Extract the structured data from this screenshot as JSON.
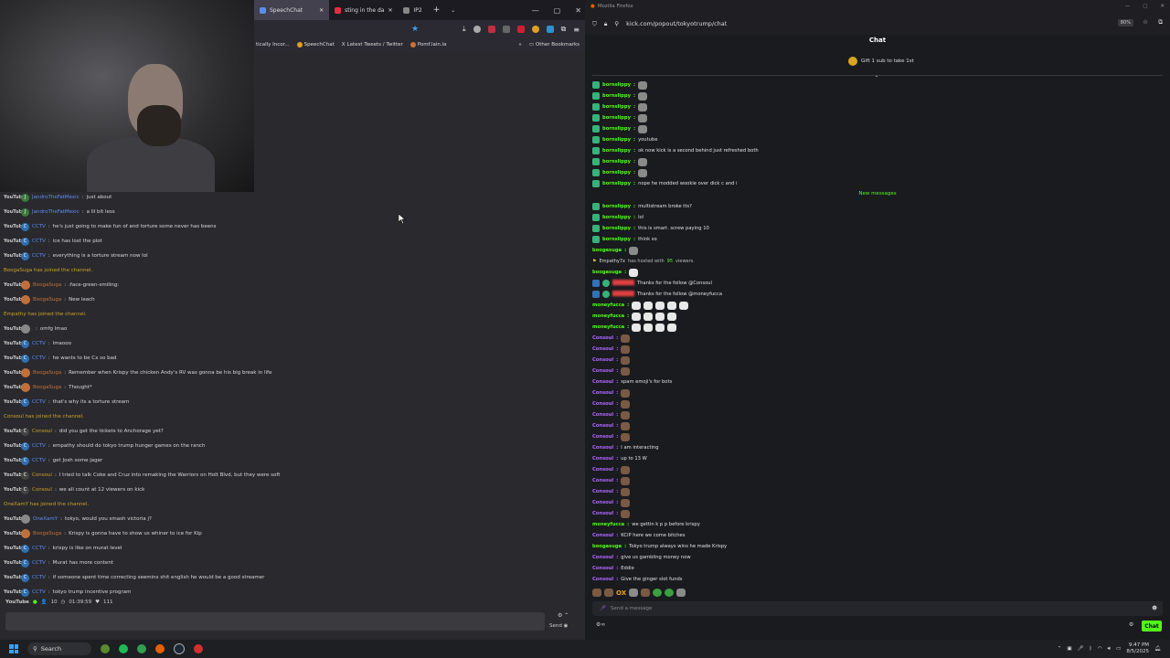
{
  "left_window": {
    "tabs": [
      {
        "label": "SpeechChat",
        "active": true,
        "color": "#5b8def"
      },
      {
        "label": "sting in the da",
        "active": false,
        "color": "#e03040"
      },
      {
        "label": "IP2",
        "active": false,
        "color": "#888888"
      }
    ],
    "new_tab": "+",
    "bookmarks": [
      {
        "label": "tically Incor..."
      },
      {
        "label": "SpeechChat"
      },
      {
        "label": "Latest Tweets / Twitter"
      },
      {
        "label": "Pomf.lain.la"
      }
    ],
    "other_bookmarks": "Other Bookmarks",
    "chat": [
      {
        "platform": "YouTube",
        "badge": "J",
        "user": "JandroTheFatMexic",
        "msg": "just about",
        "kind": "msg",
        "ucolor": "#5b8def"
      },
      {
        "platform": "YouTube",
        "badge": "J",
        "user": "JandroTheFatMexic",
        "msg": "a lil bit less",
        "kind": "msg",
        "ucolor": "#5b8def"
      },
      {
        "platform": "YouTube",
        "badge": "C",
        "user": "CCTV",
        "msg": "he's just going to make fun of and torture some never has beens",
        "kind": "msg",
        "ucolor": "#5b8def"
      },
      {
        "platform": "YouTube",
        "badge": "C",
        "user": "CCTV",
        "msg": "ice has lost the plot",
        "kind": "msg",
        "ucolor": "#5b8def"
      },
      {
        "platform": "YouTube",
        "badge": "C",
        "user": "CCTV",
        "msg": "everything is a torture stream now lol",
        "kind": "msg",
        "ucolor": "#5b8def"
      },
      {
        "text": "BoogaSuga has joined the channel.",
        "kind": "join"
      },
      {
        "platform": "YouTube",
        "badge": "av",
        "user": "BoogaSuga",
        "msg": ":face-green-smiling:",
        "kind": "msg",
        "ucolor": "#c2703b"
      },
      {
        "platform": "YouTube",
        "badge": "av",
        "user": "BoogaSuga",
        "msg": "New leach",
        "kind": "msg",
        "ucolor": "#c2703b"
      },
      {
        "text": "Empathy has joined the channel.",
        "kind": "join"
      },
      {
        "platform": "YouTube",
        "badge": "avg",
        "user": "",
        "msg": "omfg lmao",
        "kind": "msg",
        "ucolor": "#e04040"
      },
      {
        "platform": "YouTube",
        "badge": "C",
        "user": "CCTV",
        "msg": "lmaooo",
        "kind": "msg",
        "ucolor": "#5b8def"
      },
      {
        "platform": "YouTube",
        "badge": "C",
        "user": "CCTV",
        "msg": "he wants to be Cx so bad",
        "kind": "msg",
        "ucolor": "#5b8def"
      },
      {
        "platform": "YouTube",
        "badge": "av",
        "user": "BoogaSuga",
        "msg": "Remember when Krispy the chicken Andy's RV was gonna be his big break in life",
        "kind": "msg",
        "ucolor": "#c2703b"
      },
      {
        "platform": "YouTube",
        "badge": "av",
        "user": "BoogaSuga",
        "msg": "Thought*",
        "kind": "msg",
        "ucolor": "#c2703b"
      },
      {
        "platform": "YouTube",
        "badge": "C",
        "user": "CCTV",
        "msg": "that's why its a torture stream",
        "kind": "msg",
        "ucolor": "#5b8def"
      },
      {
        "text": "Consoul has joined the channel.",
        "kind": "join"
      },
      {
        "platform": "YouTube",
        "badge": "Cp",
        "user": "Consoul",
        "msg": "did you get the tickets to Anchorage yet?",
        "kind": "msg",
        "ucolor": "#c9a227"
      },
      {
        "platform": "YouTube",
        "badge": "C",
        "user": "CCTV",
        "msg": "empathy should do tokyo trump hunger games on the ranch",
        "kind": "msg",
        "ucolor": "#5b8def"
      },
      {
        "platform": "YouTube",
        "badge": "C",
        "user": "CCTV",
        "msg": "get Josh some jager",
        "kind": "msg",
        "ucolor": "#5b8def"
      },
      {
        "platform": "YouTube",
        "badge": "Cp",
        "user": "Consoul",
        "msg": "I tried to talk Coke and Cruz into remaking the Warriors on Holt Blvd, but they were soft",
        "kind": "msg",
        "ucolor": "#c9a227"
      },
      {
        "platform": "YouTube",
        "badge": "Cp",
        "user": "Consoul",
        "msg": "we all count at 12 viewers on kick",
        "kind": "msg",
        "ucolor": "#c9a227"
      },
      {
        "text": "OneXamY has joined the channel.",
        "kind": "join"
      },
      {
        "platform": "YouTube",
        "badge": "avg",
        "user": "OneXamY",
        "msg": "tokyo, would you smash victoria j?",
        "kind": "msg",
        "ucolor": "#5b8def"
      },
      {
        "platform": "YouTube",
        "badge": "av",
        "user": "BoogaSuga",
        "msg": "Krispy is gonna have to show us whiner to ice for Kip",
        "kind": "msg",
        "ucolor": "#c2703b"
      },
      {
        "platform": "YouTube",
        "badge": "C",
        "user": "CCTV",
        "msg": "krispy is like on murat level",
        "kind": "msg",
        "ucolor": "#5b8def"
      },
      {
        "platform": "YouTube",
        "badge": "C",
        "user": "CCTV",
        "msg": "Murat has more content",
        "kind": "msg",
        "ucolor": "#5b8def"
      },
      {
        "platform": "YouTube",
        "badge": "C",
        "user": "CCTV",
        "msg": "if someone spent time correcting seemins shit english he would be a good streamer",
        "kind": "msg",
        "ucolor": "#5b8def"
      },
      {
        "platform": "YouTube",
        "badge": "C",
        "user": "CCTV",
        "msg": "tokyo trump incentive program",
        "kind": "msg",
        "ucolor": "#5b8def"
      }
    ],
    "stats": {
      "platform": "YouTube",
      "viewers": "10",
      "uptime": "01:39:59",
      "likes": "111"
    },
    "send_label": "Send"
  },
  "right_window": {
    "title": "Mozilla Firefox",
    "url": "kick.com/popout/tokyotrump/chat",
    "zoom": "80%",
    "chat_title": "Chat",
    "pinned": "Gift 1 sub to take 1st",
    "new_messages": "New messages",
    "host": {
      "user": "Empathy7x",
      "pre": "has hosted with",
      "count": "95",
      "post": "viewers."
    },
    "messages": [
      {
        "badge": "g",
        "user": "bornslippy",
        "cls": "u-green",
        "msg": "",
        "emotes": [
          "g"
        ]
      },
      {
        "badge": "g",
        "user": "bornslippy",
        "cls": "u-green",
        "msg": "",
        "emotes": [
          "g"
        ]
      },
      {
        "badge": "g",
        "user": "bornslippy",
        "cls": "u-green",
        "msg": "",
        "emotes": [
          "g"
        ]
      },
      {
        "badge": "g",
        "user": "bornslippy",
        "cls": "u-green",
        "msg": "",
        "emotes": [
          "g"
        ]
      },
      {
        "badge": "g",
        "user": "bornslippy",
        "cls": "u-green",
        "msg": "",
        "emotes": [
          "g"
        ]
      },
      {
        "badge": "g",
        "user": "bornslippy",
        "cls": "u-green",
        "msg": "youtube",
        "emotes": []
      },
      {
        "badge": "g",
        "user": "bornslippy",
        "cls": "u-green",
        "msg": "ok now kick is a second behind just refreshed both",
        "emotes": []
      },
      {
        "badge": "g",
        "user": "bornslippy",
        "cls": "u-green",
        "msg": "",
        "emotes": [
          "g"
        ]
      },
      {
        "badge": "g",
        "user": "bornslippy",
        "cls": "u-green",
        "msg": "",
        "emotes": [
          "g"
        ]
      },
      {
        "badge": "g",
        "user": "bornslippy",
        "cls": "u-green",
        "msg": "nope he modded wookie over dick c and i",
        "emotes": []
      },
      {
        "badge": "g",
        "user": "bornslippy",
        "cls": "u-green",
        "msg": "multistream broke tts?",
        "emotes": []
      },
      {
        "badge": "g",
        "user": "bornslippy",
        "cls": "u-green",
        "msg": "lol",
        "emotes": []
      },
      {
        "badge": "g",
        "user": "bornslippy",
        "cls": "u-green",
        "msg": "this is smart. screw paying 10",
        "emotes": []
      },
      {
        "badge": "g",
        "user": "bornslippy",
        "cls": "u-green",
        "msg": "think so",
        "emotes": []
      },
      {
        "badge": "",
        "user": "boogasuga",
        "cls": "u-green",
        "msg": "",
        "emotes": [
          "g"
        ]
      },
      {
        "badge": "",
        "user": "boogasuga",
        "cls": "u-green",
        "msg": "",
        "emotes": [
          "w"
        ]
      },
      {
        "badge": "b",
        "user": "",
        "cls": "u-red",
        "msg": "Thanks for the follow @Consoul",
        "emotes": []
      },
      {
        "badge": "b",
        "user": "",
        "cls": "u-red",
        "msg": "Thanks for the follow @moneyfucca",
        "emotes": []
      },
      {
        "badge": "",
        "user": "moneyfucca",
        "cls": "u-green",
        "msg": "",
        "emotes": [
          "w",
          "w",
          "w",
          "w",
          "w"
        ]
      },
      {
        "badge": "",
        "user": "moneyfucca",
        "cls": "u-green",
        "msg": "",
        "emotes": [
          "w",
          "w",
          "w",
          "w"
        ]
      },
      {
        "badge": "",
        "user": "moneyfucca",
        "cls": "u-green",
        "msg": "",
        "emotes": [
          "w",
          "w",
          "w",
          "w"
        ]
      },
      {
        "badge": "",
        "user": "Consoul",
        "cls": "u-purple",
        "msg": "",
        "emotes": [
          "b"
        ]
      },
      {
        "badge": "",
        "user": "Consoul",
        "cls": "u-purple",
        "msg": "",
        "emotes": [
          "b"
        ]
      },
      {
        "badge": "",
        "user": "Consoul",
        "cls": "u-purple",
        "msg": "",
        "emotes": [
          "b"
        ]
      },
      {
        "badge": "",
        "user": "Consoul",
        "cls": "u-purple",
        "msg": "",
        "emotes": [
          "b"
        ]
      },
      {
        "badge": "",
        "user": "Consoul",
        "cls": "u-purple",
        "msg": "spam emoji's for bots",
        "emotes": []
      },
      {
        "badge": "",
        "user": "Consoul",
        "cls": "u-purple",
        "msg": "",
        "emotes": [
          "b"
        ]
      },
      {
        "badge": "",
        "user": "Consoul",
        "cls": "u-purple",
        "msg": "",
        "emotes": [
          "b"
        ]
      },
      {
        "badge": "",
        "user": "Consoul",
        "cls": "u-purple",
        "msg": "",
        "emotes": [
          "b"
        ]
      },
      {
        "badge": "",
        "user": "Consoul",
        "cls": "u-purple",
        "msg": "",
        "emotes": [
          "b"
        ]
      },
      {
        "badge": "",
        "user": "Consoul",
        "cls": "u-purple",
        "msg": "",
        "emotes": [
          "b"
        ]
      },
      {
        "badge": "",
        "user": "Consoul",
        "cls": "u-purple",
        "msg": "I am interacting",
        "emotes": []
      },
      {
        "badge": "",
        "user": "Consoul",
        "cls": "u-purple",
        "msg": "up to 13 W",
        "emotes": []
      },
      {
        "badge": "",
        "user": "Consoul",
        "cls": "u-purple",
        "msg": "",
        "emotes": [
          "b"
        ]
      },
      {
        "badge": "",
        "user": "Consoul",
        "cls": "u-purple",
        "msg": "",
        "emotes": [
          "b"
        ]
      },
      {
        "badge": "",
        "user": "Consoul",
        "cls": "u-purple",
        "msg": "",
        "emotes": [
          "b"
        ]
      },
      {
        "badge": "",
        "user": "Consoul",
        "cls": "u-purple",
        "msg": "",
        "emotes": [
          "b"
        ]
      },
      {
        "badge": "",
        "user": "Consoul",
        "cls": "u-purple",
        "msg": "",
        "emotes": [
          "b"
        ]
      },
      {
        "badge": "",
        "user": "moneyfucca",
        "cls": "u-green",
        "msg": "we gettin k p p before krispy",
        "emotes": []
      },
      {
        "badge": "",
        "user": "Consoul",
        "cls": "u-purple",
        "msg": "KCIP here we come bitches",
        "emotes": []
      },
      {
        "badge": "",
        "user": "boogasuga",
        "cls": "u-green",
        "msg": "Tokyo trump always wins he made Krispy",
        "emotes": []
      },
      {
        "badge": "",
        "user": "Consoul",
        "cls": "u-purple",
        "msg": "give us gambling money now",
        "emotes": []
      },
      {
        "badge": "",
        "user": "Consoul",
        "cls": "u-purple",
        "msg": "Eddie",
        "emotes": []
      },
      {
        "badge": "",
        "user": "Consoul",
        "cls": "u-purple",
        "msg": "Give the ginger slot funds",
        "emotes": []
      }
    ],
    "emote_bar": "OX",
    "input_placeholder": "Send a message",
    "chat_button": "Chat"
  },
  "taskbar": {
    "search_label": "Search",
    "time": "9:47 PM",
    "date": "8/5/2025"
  },
  "colors": {
    "kick_green": "#53fc18",
    "consoul_purple": "#b266ff",
    "join_gold": "#c9a227"
  }
}
